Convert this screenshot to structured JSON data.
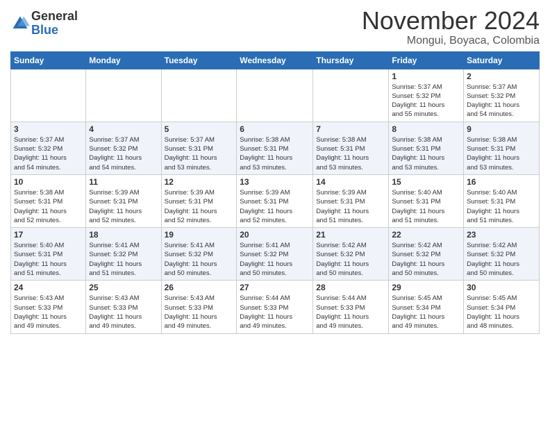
{
  "header": {
    "logo_general": "General",
    "logo_blue": "Blue",
    "month_title": "November 2024",
    "location": "Mongui, Boyaca, Colombia"
  },
  "weekdays": [
    "Sunday",
    "Monday",
    "Tuesday",
    "Wednesday",
    "Thursday",
    "Friday",
    "Saturday"
  ],
  "weeks": [
    [
      {
        "day": "",
        "info": ""
      },
      {
        "day": "",
        "info": ""
      },
      {
        "day": "",
        "info": ""
      },
      {
        "day": "",
        "info": ""
      },
      {
        "day": "",
        "info": ""
      },
      {
        "day": "1",
        "info": "Sunrise: 5:37 AM\nSunset: 5:32 PM\nDaylight: 11 hours\nand 55 minutes."
      },
      {
        "day": "2",
        "info": "Sunrise: 5:37 AM\nSunset: 5:32 PM\nDaylight: 11 hours\nand 54 minutes."
      }
    ],
    [
      {
        "day": "3",
        "info": "Sunrise: 5:37 AM\nSunset: 5:32 PM\nDaylight: 11 hours\nand 54 minutes."
      },
      {
        "day": "4",
        "info": "Sunrise: 5:37 AM\nSunset: 5:32 PM\nDaylight: 11 hours\nand 54 minutes."
      },
      {
        "day": "5",
        "info": "Sunrise: 5:37 AM\nSunset: 5:31 PM\nDaylight: 11 hours\nand 53 minutes."
      },
      {
        "day": "6",
        "info": "Sunrise: 5:38 AM\nSunset: 5:31 PM\nDaylight: 11 hours\nand 53 minutes."
      },
      {
        "day": "7",
        "info": "Sunrise: 5:38 AM\nSunset: 5:31 PM\nDaylight: 11 hours\nand 53 minutes."
      },
      {
        "day": "8",
        "info": "Sunrise: 5:38 AM\nSunset: 5:31 PM\nDaylight: 11 hours\nand 53 minutes."
      },
      {
        "day": "9",
        "info": "Sunrise: 5:38 AM\nSunset: 5:31 PM\nDaylight: 11 hours\nand 53 minutes."
      }
    ],
    [
      {
        "day": "10",
        "info": "Sunrise: 5:38 AM\nSunset: 5:31 PM\nDaylight: 11 hours\nand 52 minutes."
      },
      {
        "day": "11",
        "info": "Sunrise: 5:39 AM\nSunset: 5:31 PM\nDaylight: 11 hours\nand 52 minutes."
      },
      {
        "day": "12",
        "info": "Sunrise: 5:39 AM\nSunset: 5:31 PM\nDaylight: 11 hours\nand 52 minutes."
      },
      {
        "day": "13",
        "info": "Sunrise: 5:39 AM\nSunset: 5:31 PM\nDaylight: 11 hours\nand 52 minutes."
      },
      {
        "day": "14",
        "info": "Sunrise: 5:39 AM\nSunset: 5:31 PM\nDaylight: 11 hours\nand 51 minutes."
      },
      {
        "day": "15",
        "info": "Sunrise: 5:40 AM\nSunset: 5:31 PM\nDaylight: 11 hours\nand 51 minutes."
      },
      {
        "day": "16",
        "info": "Sunrise: 5:40 AM\nSunset: 5:31 PM\nDaylight: 11 hours\nand 51 minutes."
      }
    ],
    [
      {
        "day": "17",
        "info": "Sunrise: 5:40 AM\nSunset: 5:31 PM\nDaylight: 11 hours\nand 51 minutes."
      },
      {
        "day": "18",
        "info": "Sunrise: 5:41 AM\nSunset: 5:32 PM\nDaylight: 11 hours\nand 51 minutes."
      },
      {
        "day": "19",
        "info": "Sunrise: 5:41 AM\nSunset: 5:32 PM\nDaylight: 11 hours\nand 50 minutes."
      },
      {
        "day": "20",
        "info": "Sunrise: 5:41 AM\nSunset: 5:32 PM\nDaylight: 11 hours\nand 50 minutes."
      },
      {
        "day": "21",
        "info": "Sunrise: 5:42 AM\nSunset: 5:32 PM\nDaylight: 11 hours\nand 50 minutes."
      },
      {
        "day": "22",
        "info": "Sunrise: 5:42 AM\nSunset: 5:32 PM\nDaylight: 11 hours\nand 50 minutes."
      },
      {
        "day": "23",
        "info": "Sunrise: 5:42 AM\nSunset: 5:32 PM\nDaylight: 11 hours\nand 50 minutes."
      }
    ],
    [
      {
        "day": "24",
        "info": "Sunrise: 5:43 AM\nSunset: 5:33 PM\nDaylight: 11 hours\nand 49 minutes."
      },
      {
        "day": "25",
        "info": "Sunrise: 5:43 AM\nSunset: 5:33 PM\nDaylight: 11 hours\nand 49 minutes."
      },
      {
        "day": "26",
        "info": "Sunrise: 5:43 AM\nSunset: 5:33 PM\nDaylight: 11 hours\nand 49 minutes."
      },
      {
        "day": "27",
        "info": "Sunrise: 5:44 AM\nSunset: 5:33 PM\nDaylight: 11 hours\nand 49 minutes."
      },
      {
        "day": "28",
        "info": "Sunrise: 5:44 AM\nSunset: 5:33 PM\nDaylight: 11 hours\nand 49 minutes."
      },
      {
        "day": "29",
        "info": "Sunrise: 5:45 AM\nSunset: 5:34 PM\nDaylight: 11 hours\nand 49 minutes."
      },
      {
        "day": "30",
        "info": "Sunrise: 5:45 AM\nSunset: 5:34 PM\nDaylight: 11 hours\nand 48 minutes."
      }
    ]
  ]
}
